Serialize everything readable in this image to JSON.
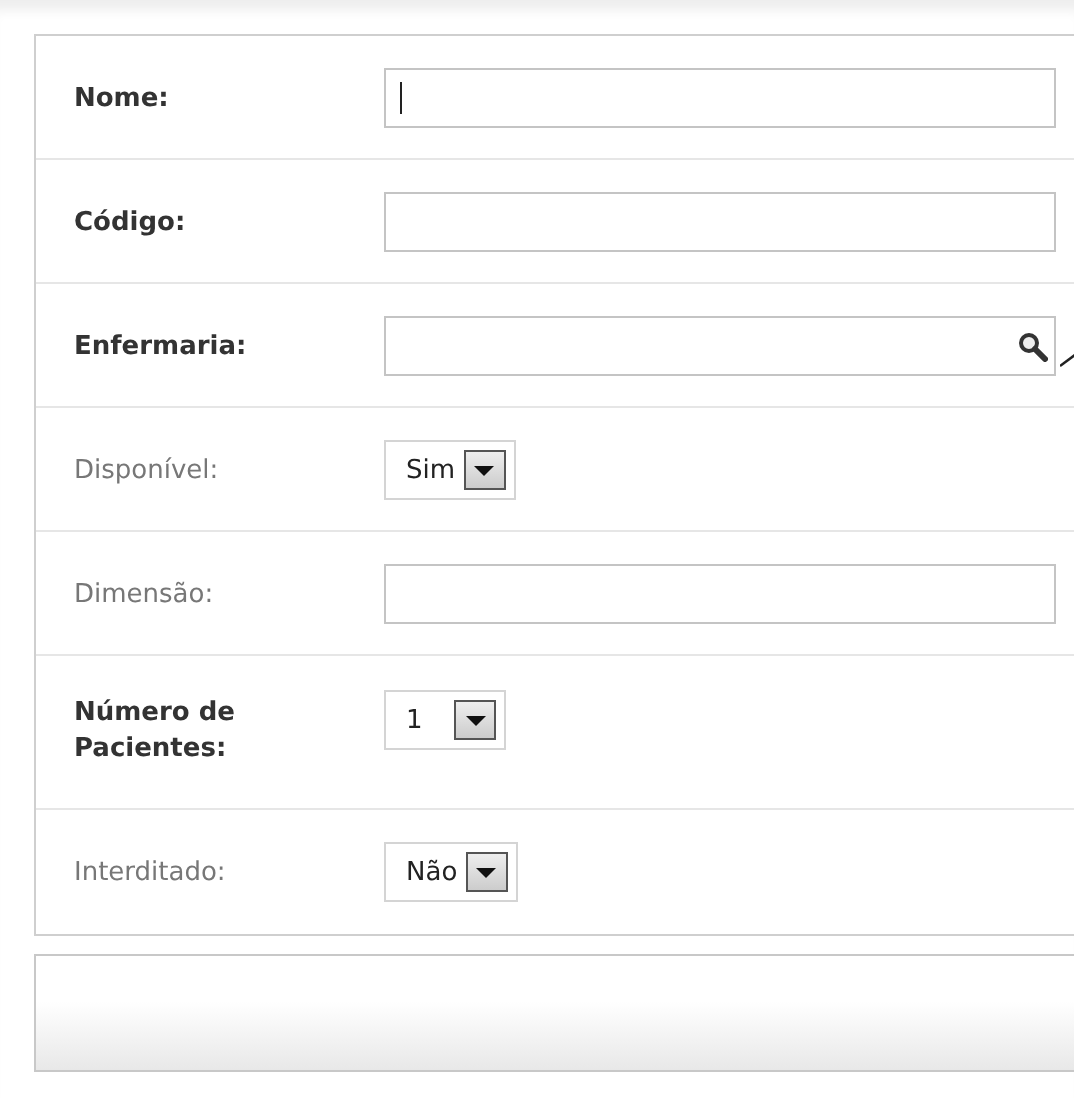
{
  "form": {
    "fields": [
      {
        "kind": "text",
        "label": "Nome:",
        "required": true,
        "focused": true
      },
      {
        "kind": "text",
        "label": "Código:",
        "required": true,
        "focused": false
      },
      {
        "kind": "lookup",
        "label": "Enfermaria:",
        "required": true,
        "focused": false
      },
      {
        "kind": "select",
        "label": "Disponível:",
        "required": false,
        "value": "Sim"
      },
      {
        "kind": "text",
        "label": "Dimensão:",
        "required": false,
        "focused": false
      },
      {
        "kind": "select",
        "label": "Número de Pacientes:",
        "required": true,
        "value": "1"
      },
      {
        "kind": "select",
        "label": "Interditado:",
        "required": false,
        "value": "Não"
      }
    ]
  }
}
